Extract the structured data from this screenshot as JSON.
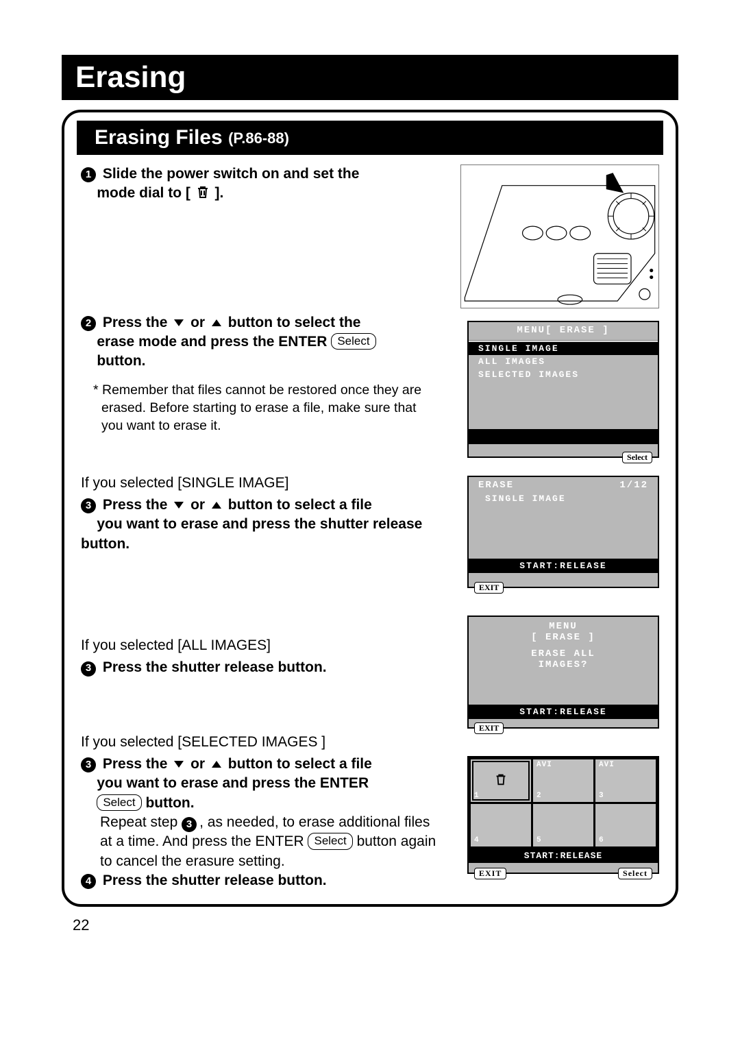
{
  "title": "Erasing",
  "subtitle": "Erasing Files",
  "subtitle_ref": "(P.86-88)",
  "page_number": "22",
  "steps": {
    "s1": {
      "num": "1",
      "text_a": "Slide the power switch on and set the",
      "text_b": "mode dial to [",
      "text_c": "]."
    },
    "s2": {
      "num": "2",
      "text_a": "Press the",
      "text_b": "or",
      "text_c": "button to select the",
      "text_d": "erase mode and press the ENTER",
      "text_e": "button.",
      "select_label": "Select",
      "note": "* Remember that files cannot be restored once they are erased.  Before starting to erase a file, make sure that you want to erase it."
    },
    "s3a": {
      "cond": "If you selected [SINGLE IMAGE]",
      "num": "3",
      "text_a": "Press the",
      "text_b": "or",
      "text_c": "button to select a file",
      "text_d": "you want to erase and press the shutter release button."
    },
    "s3b": {
      "cond": "If you selected [ALL IMAGES]",
      "num": "3",
      "text": "Press the shutter release button."
    },
    "s3c": {
      "cond": "If you selected [SELECTED IMAGES ]",
      "num": "3",
      "text_a": "Press the",
      "text_b": "or",
      "text_c": "button to select a file",
      "text_d": "you want to erase and press the ENTER",
      "select_label": "Select",
      "text_e": "button.",
      "repeat_a": "Repeat step",
      "repeat_num": "3",
      "repeat_b": ", as needed, to erase additional files at a time. And press the ENTER",
      "repeat_select": "Select",
      "repeat_c": "button again to cancel the erasure setting."
    },
    "s4": {
      "num": "4",
      "text": "Press the shutter release button."
    }
  },
  "screens": {
    "menu": {
      "header": "MENU[ ERASE ]",
      "items": [
        "SINGLE IMAGE",
        "ALL IMAGES",
        "SELECTED IMAGES"
      ],
      "select_btn": "Select"
    },
    "single": {
      "title": "ERASE",
      "count": "1/12",
      "mode": "SINGLE IMAGE",
      "start": "START:RELEASE",
      "exit": "EXIT"
    },
    "all": {
      "l1": "MENU",
      "l2": "[ ERASE ]",
      "q1": "ERASE ALL",
      "q2": "IMAGES?",
      "start": "START:RELEASE",
      "exit": "EXIT"
    },
    "grid": {
      "cells": [
        {
          "n": "1",
          "top": ""
        },
        {
          "n": "2",
          "top": "AVI"
        },
        {
          "n": "3",
          "top": "AVI"
        },
        {
          "n": "4",
          "top": ""
        },
        {
          "n": "5",
          "top": ""
        },
        {
          "n": "6",
          "top": ""
        }
      ],
      "start": "START:RELEASE",
      "exit": "EXIT",
      "select": "Select"
    }
  }
}
